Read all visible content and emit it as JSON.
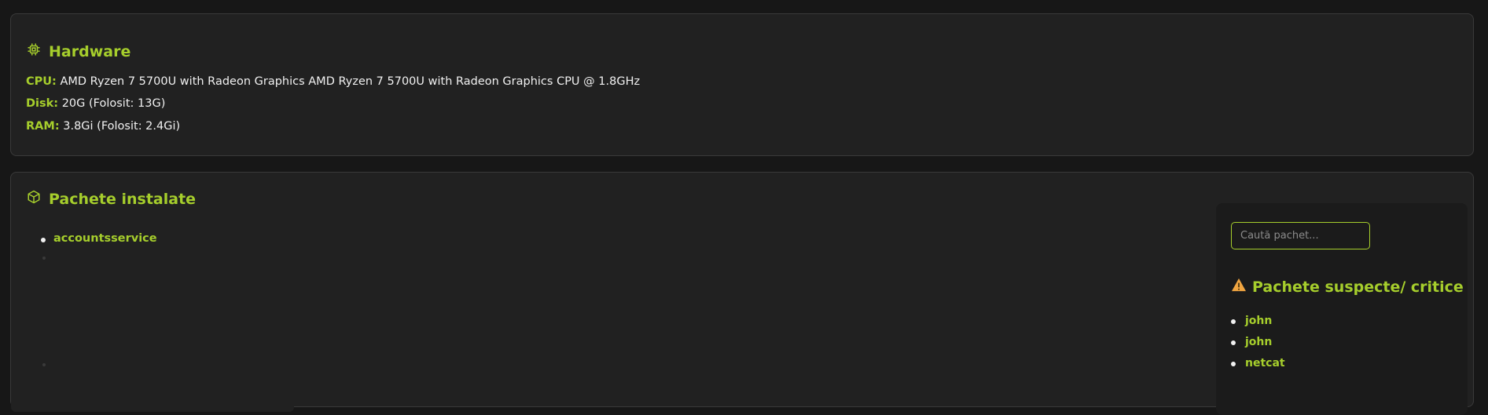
{
  "hardware": {
    "title": "Hardware",
    "icon": "cpu-chip-icon",
    "cpu_label": "CPU:",
    "cpu_value": "AMD Ryzen 7 5700U with Radeon Graphics AMD Ryzen 7 5700U with Radeon Graphics CPU @ 1.8GHz",
    "disk_label": "Disk:",
    "disk_value": "20G (Folosit: 13G)",
    "ram_label": "RAM:",
    "ram_value": "3.8Gi (Folosit: 2.4Gi)"
  },
  "packages": {
    "title": "Pachete instalate",
    "icon": "package-icon",
    "items": [
      "accountsservice"
    ]
  },
  "side_panel": {
    "search_placeholder": "Caută pachet...",
    "suspect_title": "Pachete suspecte/ critice",
    "suspect_icon": "warning-icon",
    "suspect_items": [
      "john",
      "john",
      "netcat"
    ]
  },
  "colors": {
    "accent": "#a6ce2c",
    "background": "#171717",
    "card": "#212121",
    "warning": "#f0a541"
  }
}
